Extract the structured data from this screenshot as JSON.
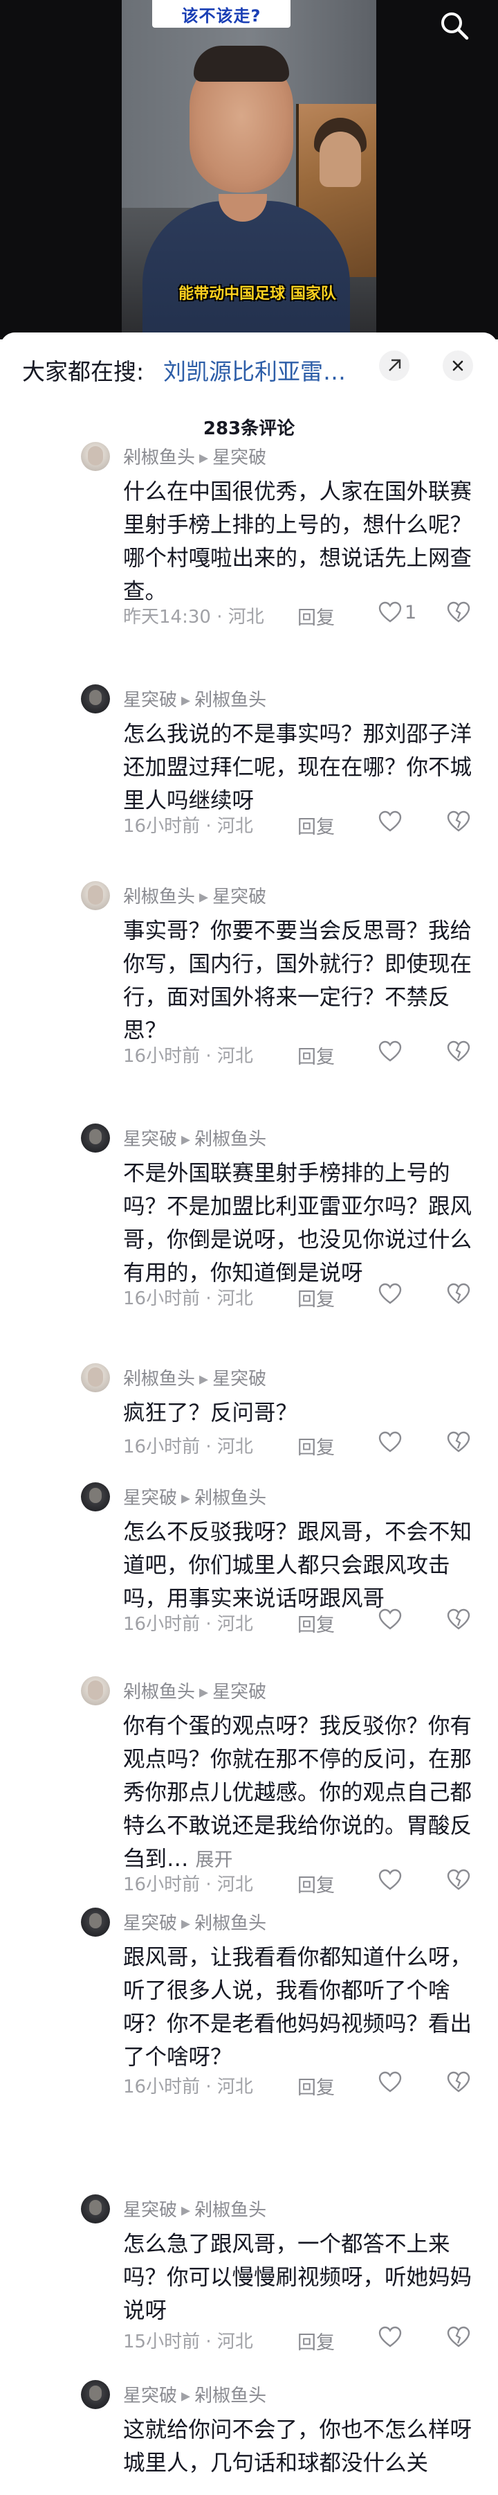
{
  "video": {
    "banner_text": "该不该走?",
    "subtitle": "能带动中国足球 国家队",
    "search_icon": "search-icon"
  },
  "search_bar": {
    "label": "大家都在搜:",
    "query": "刘凯源比利亚雷…",
    "arrow_icon": "arrow-diagonal-icon",
    "close_icon": "close-icon"
  },
  "comment_count": "283条评论",
  "comments": [
    {
      "author": "剁椒鱼头",
      "reply_to": "星突破",
      "text": "什么在中国很优秀，人家在国外联赛里射手榜上排的上号的，想什么呢？哪个村嘎啦出来的，想说话先上网查查。",
      "time_loc": "昨天14:30 · 河北",
      "reply": "回复",
      "likes": "1"
    },
    {
      "author": "星突破",
      "reply_to": "剁椒鱼头",
      "text": "怎么我说的不是事实吗？那刘邵子洋还加盟过拜仁呢，现在在哪？你不城里人吗继续呀",
      "time_loc": "16小时前 · 河北",
      "reply": "回复",
      "likes": ""
    },
    {
      "author": "剁椒鱼头",
      "reply_to": "星突破",
      "text": "事实哥？你要不要当会反思哥？我给你写，国内行，国外就行？即使现在行，面对国外将来一定行？不禁反思？",
      "time_loc": "16小时前 · 河北",
      "reply": "回复",
      "likes": ""
    },
    {
      "author": "星突破",
      "reply_to": "剁椒鱼头",
      "text": "不是外国联赛里射手榜排的上号的吗？不是加盟比利亚雷亚尔吗？跟风哥，你倒是说呀，也没见你说过什么有用的，你知道倒是说呀",
      "time_loc": "16小时前 · 河北",
      "reply": "回复",
      "likes": ""
    },
    {
      "author": "剁椒鱼头",
      "reply_to": "星突破",
      "text": "疯狂了？反问哥？",
      "time_loc": "16小时前 · 河北",
      "reply": "回复",
      "likes": ""
    },
    {
      "author": "星突破",
      "reply_to": "剁椒鱼头",
      "text": "怎么不反驳我呀？跟风哥，不会不知道吧，你们城里人都只会跟风攻击吗，用事实来说话呀跟风哥",
      "time_loc": "16小时前 · 河北",
      "reply": "回复",
      "likes": ""
    },
    {
      "author": "剁椒鱼头",
      "reply_to": "星突破",
      "text": "你有个蛋的观点呀？我反驳你？你有观点吗？你就在那不停的反问，在那秀你那点儿优越感。你的观点自己都特么不敢说还是我给你说的。胃酸反刍到…",
      "expand": "展开",
      "time_loc": "16小时前 · 河北",
      "reply": "回复",
      "likes": ""
    },
    {
      "author": "星突破",
      "reply_to": "剁椒鱼头",
      "text": "跟风哥，让我看看你都知道什么呀，听了很多人说，我看你都听了个啥呀？你不是老看他妈妈视频吗？看出了个啥呀？",
      "time_loc": "16小时前 · 河北",
      "reply": "回复",
      "likes": ""
    },
    {
      "author": "星突破",
      "reply_to": "剁椒鱼头",
      "text": "怎么急了跟风哥，一个都答不上来吗？你可以慢慢刷视频呀，听她妈妈说呀",
      "time_loc": "15小时前 · 河北",
      "reply": "回复",
      "likes": ""
    },
    {
      "author": "星突破",
      "reply_to": "剁椒鱼头",
      "text": "这就给你问不会了，你也不怎么样呀城里人，几句话和球都没什么关",
      "time_loc": "",
      "reply": "",
      "likes": ""
    }
  ],
  "colors": {
    "accent_link": "#2d5ea8",
    "meta_gray": "#8a8b91",
    "subtitle_yellow": "#ffd21f"
  }
}
